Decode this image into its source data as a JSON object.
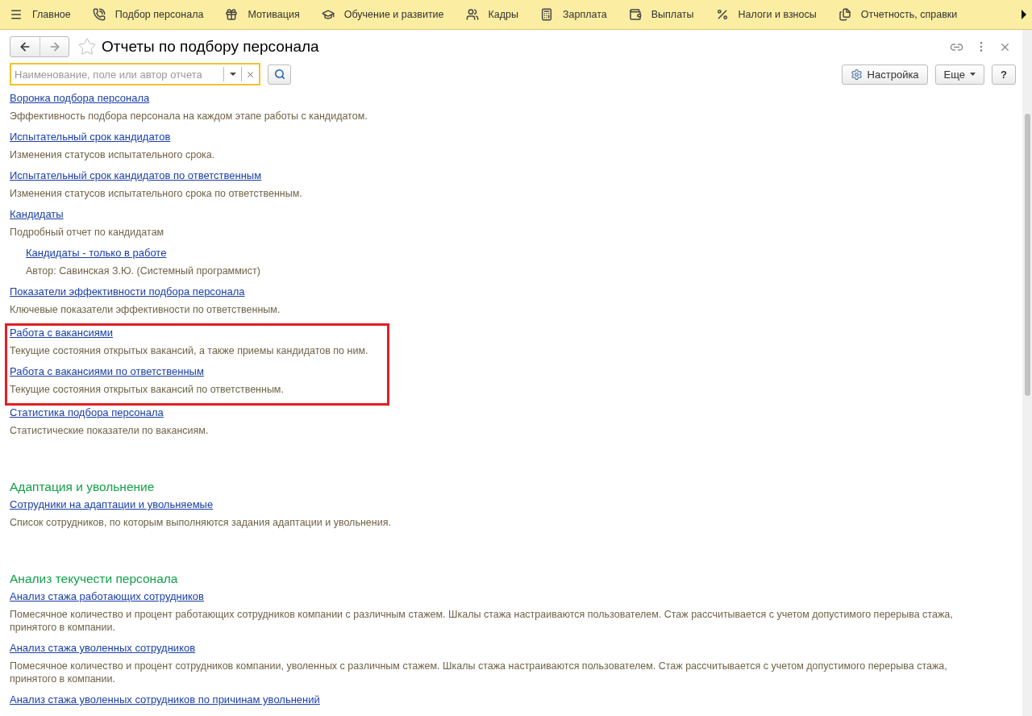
{
  "menu": [
    {
      "label": "Главное"
    },
    {
      "label": "Подбор персонала"
    },
    {
      "label": "Мотивация"
    },
    {
      "label": "Обучение и развитие"
    },
    {
      "label": "Кадры"
    },
    {
      "label": "Зарплата"
    },
    {
      "label": "Выплаты"
    },
    {
      "label": "Налоги и взносы"
    },
    {
      "label": "Отчетность, справки"
    }
  ],
  "window": {
    "title": "Отчеты по подбору персонала",
    "favorite": false
  },
  "search": {
    "placeholder": "Наименование, поле или автор отчета"
  },
  "buttons": {
    "settings": "Настройка",
    "more": "Еще",
    "help": "?"
  },
  "sections": [
    {
      "reports": [
        {
          "title": "Воронка подбора персонала",
          "description": "Эффективность подбора персонала на каждом этапе работы с кандидатом.",
          "highlighted": false
        },
        {
          "title": "Испытательный срок кандидатов",
          "description": "Изменения статусов испытательного срока.",
          "highlighted": false
        },
        {
          "title": "Испытательный срок кандидатов по ответственным",
          "description": "Изменения статусов испытательного срока по ответственным.",
          "highlighted": false
        },
        {
          "title": "Кандидаты",
          "description": "Подробный отчет по кандидатам",
          "highlighted": false,
          "children": [
            {
              "title": "Кандидаты - только в работе",
              "description": "Автор: Савинская З.Ю. (Системный программист)",
              "highlighted": false
            }
          ]
        },
        {
          "title": "Показатели эффективности подбора персонала",
          "description": "Ключевые показатели эффективности по ответственным.",
          "highlighted": false
        },
        {
          "title": "Работа с вакансиями",
          "description": "Текущие состояния открытых вакансий, а также приемы кандидатов по ним.",
          "highlighted": true
        },
        {
          "title": "Работа с вакансиями по ответственным",
          "description": "Текущие состояния открытых вакансий по ответственным.",
          "highlighted": true
        },
        {
          "title": "Статистика подбора персонала",
          "description": "Статистические показатели по вакансиям.",
          "highlighted": false
        }
      ]
    },
    {
      "heading": "Адаптация и увольнение",
      "reports": [
        {
          "title": "Сотрудники на адаптации и увольняемые",
          "description": "Список сотрудников, по которым выполняются задания адаптации и увольнения.",
          "highlighted": false
        }
      ]
    },
    {
      "heading": "Анализ текучести персонала",
      "reports": [
        {
          "title": "Анализ стажа работающих сотрудников",
          "description": "Помесячное количество и процент работающих сотрудников компании с различным стажем. Шкалы стажа настраиваются пользователем. Стаж рассчитывается с учетом допустимого перерыва стажа, принятого в компании.",
          "highlighted": false
        },
        {
          "title": "Анализ стажа уволенных сотрудников",
          "description": "Помесячное количество и процент сотрудников компании, уволенных с различным стажем. Шкалы стажа настраиваются пользователем. Стаж рассчитывается с учетом допустимого перерыва стажа, принятого в компании.",
          "highlighted": false
        },
        {
          "title": "Анализ стажа уволенных сотрудников по причинам увольнений",
          "highlighted": false
        }
      ]
    }
  ]
}
